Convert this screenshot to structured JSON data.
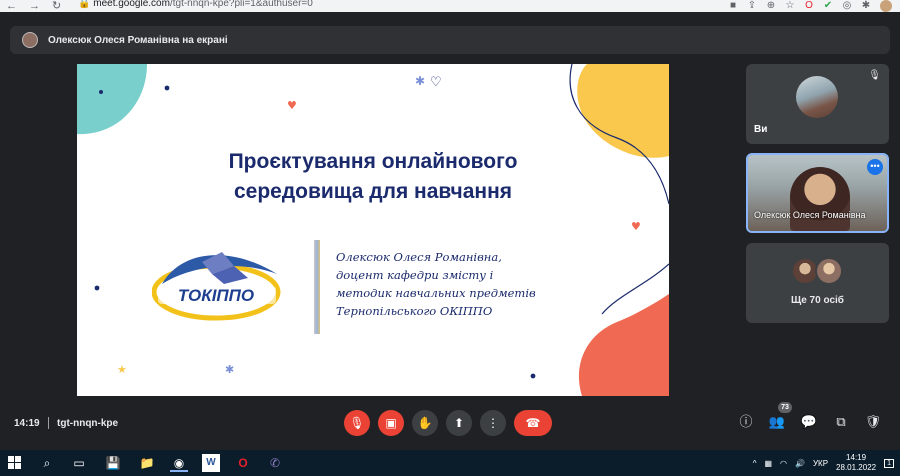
{
  "browser": {
    "url_domain": "meet.google.com",
    "url_path": "/tgt-nnqn-kpe?pli=1&authuser=0"
  },
  "presenter": {
    "label": "Олексюк Олеся Романівна на екрані"
  },
  "slide": {
    "title_line1": "Проєктування онлайнового",
    "title_line2": "середовища для навчання",
    "logo_text": "ТОКІППО",
    "author_line1": "Олексюк Олеся Романівна,",
    "author_line2": "доцент кафедри змісту і",
    "author_line3": "методик навчальних предметів",
    "author_line4": "Тернопільського ОКІППО"
  },
  "participants": {
    "self_label": "Ви",
    "speaker_label": "Олексюк Олеся Романівна",
    "others_label": "Ще 70 осіб"
  },
  "meeting": {
    "time": "14:19",
    "code": "tgt-nnqn-kpe",
    "participant_count": "73"
  },
  "taskbar": {
    "language": "УКР",
    "clock_time": "14:19",
    "clock_date": "28.01.2022",
    "notification_count": "1"
  },
  "colors": {
    "meet_background": "#202124",
    "end_call_red": "#ea4335",
    "slide_title_navy": "#1a2a6c",
    "accent_blue": "#8ab4f8"
  }
}
